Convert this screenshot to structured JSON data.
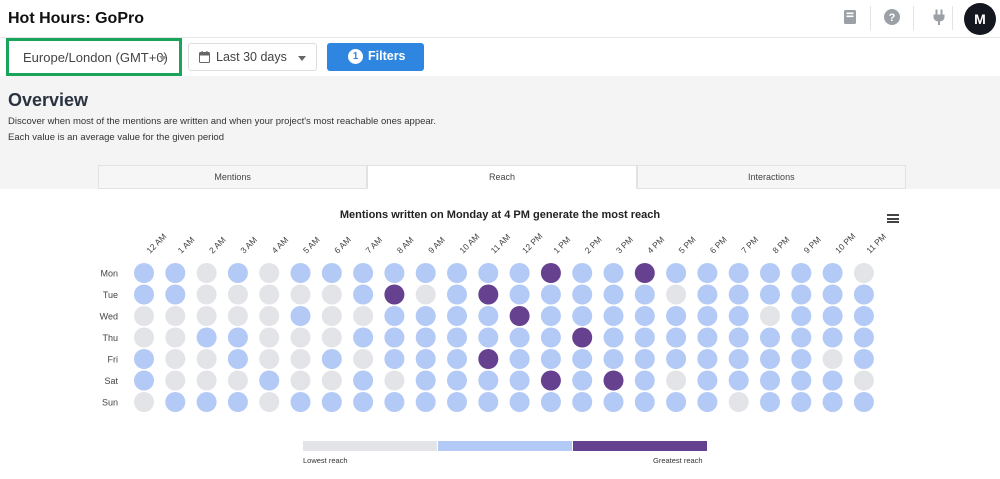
{
  "app": {
    "title": "Hot Hours: GoPro",
    "avatar_initial": "M"
  },
  "header_icons": [
    "book-icon",
    "help-icon",
    "plug-icon"
  ],
  "toolbar": {
    "timezone": "Europe/London (GMT+0)",
    "date_range": "Last 30 days",
    "filters_label": "Filters",
    "filters_count": "1"
  },
  "overview": {
    "title": "Overview",
    "description_line1": "Discover when most of the mentions are written and when your project's most reachable ones appear.",
    "description_line2": "Each value is an average value for the given period"
  },
  "tabs": [
    {
      "label": "Mentions",
      "active": false
    },
    {
      "label": "Reach",
      "active": true
    },
    {
      "label": "Interactions",
      "active": false
    }
  ],
  "colors": {
    "low": "#e3e4e8",
    "mid": "#b3c9f6",
    "high": "#66418f",
    "accent": "#2f86e0",
    "highlight_border": "#1aa35a"
  },
  "legend": {
    "low_label": "Lowest reach",
    "high_label": "Greatest reach"
  },
  "chart_data": {
    "type": "heatmap",
    "title": "Mentions written on Monday at 4 PM generate the most reach",
    "x": [
      "12 AM",
      "1 AM",
      "2 AM",
      "3 AM",
      "4 AM",
      "5 AM",
      "6 AM",
      "7 AM",
      "8 AM",
      "9 AM",
      "10 AM",
      "11 AM",
      "12 PM",
      "1 PM",
      "2 PM",
      "3 PM",
      "4 PM",
      "5 PM",
      "6 PM",
      "7 PM",
      "8 PM",
      "9 PM",
      "10 PM",
      "11 PM"
    ],
    "y": [
      "Mon",
      "Tue",
      "Wed",
      "Thu",
      "Fri",
      "Sat",
      "Sun"
    ],
    "levels": [
      "low",
      "mid",
      "high"
    ],
    "values": [
      [
        1,
        1,
        0,
        1,
        0,
        1,
        1,
        1,
        1,
        1,
        1,
        1,
        1,
        2,
        1,
        1,
        2,
        1,
        1,
        1,
        1,
        1,
        1,
        0
      ],
      [
        1,
        1,
        0,
        0,
        0,
        0,
        0,
        1,
        2,
        0,
        1,
        2,
        1,
        1,
        1,
        1,
        1,
        0,
        1,
        1,
        1,
        1,
        1,
        1
      ],
      [
        0,
        0,
        0,
        0,
        0,
        1,
        0,
        0,
        1,
        1,
        1,
        1,
        2,
        1,
        1,
        1,
        1,
        1,
        1,
        1,
        0,
        1,
        1,
        1
      ],
      [
        0,
        0,
        1,
        1,
        0,
        0,
        0,
        1,
        1,
        1,
        1,
        1,
        1,
        1,
        2,
        1,
        1,
        1,
        1,
        1,
        1,
        1,
        1,
        1
      ],
      [
        1,
        0,
        0,
        1,
        0,
        0,
        1,
        0,
        1,
        1,
        1,
        2,
        1,
        1,
        1,
        1,
        1,
        1,
        1,
        1,
        1,
        1,
        0,
        1
      ],
      [
        1,
        0,
        0,
        0,
        1,
        0,
        0,
        1,
        0,
        1,
        1,
        1,
        1,
        2,
        1,
        2,
        1,
        0,
        1,
        1,
        1,
        1,
        1,
        0
      ],
      [
        0,
        1,
        1,
        1,
        0,
        1,
        1,
        1,
        1,
        1,
        1,
        1,
        1,
        1,
        1,
        1,
        1,
        1,
        1,
        0,
        1,
        1,
        1,
        1
      ]
    ]
  }
}
